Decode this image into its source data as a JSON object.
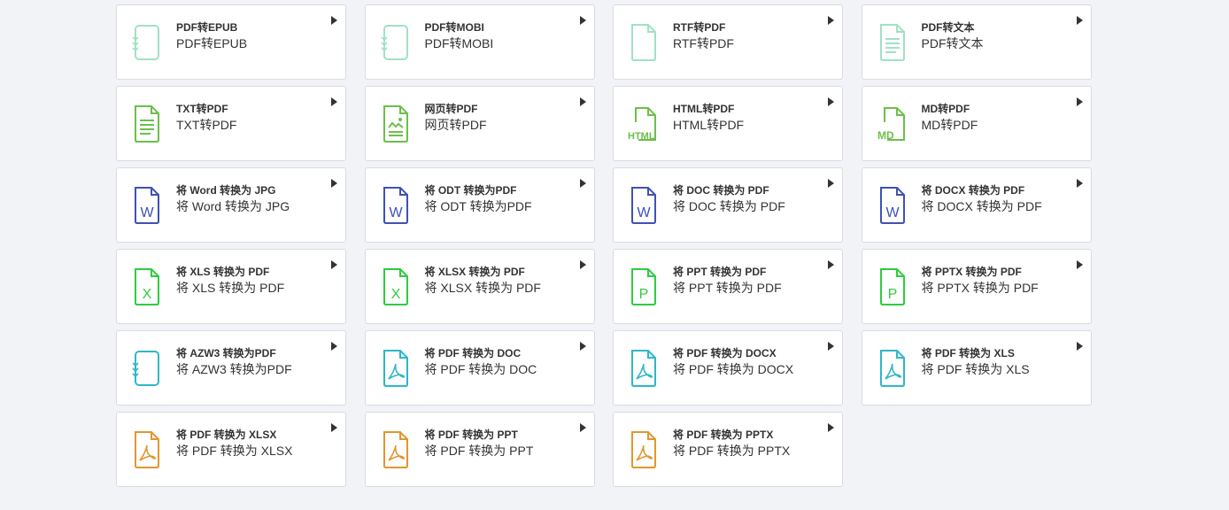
{
  "colors": {
    "mint": "#9fe2c4",
    "green": "#6cbf4a",
    "blue": "#3f51b5",
    "lime": "#2ecc40",
    "teal": "#2eb7c8",
    "orange": "#e3962e"
  },
  "cards": [
    {
      "title": "PDF转EPUB",
      "subtitle": "PDF转EPUB",
      "icon": "ebook-icon",
      "color": "#9fe2c4"
    },
    {
      "title": "PDF转MOBI",
      "subtitle": "PDF转MOBI",
      "icon": "ebook-icon",
      "color": "#9fe2c4"
    },
    {
      "title": "RTF转PDF",
      "subtitle": "RTF转PDF",
      "icon": "blank-file-icon",
      "color": "#9fe2c4"
    },
    {
      "title": "PDF转文本",
      "subtitle": "PDF转文本",
      "icon": "text-file-icon",
      "color": "#9fe2c4"
    },
    {
      "title": "TXT转PDF",
      "subtitle": "TXT转PDF",
      "icon": "text-file-icon",
      "color": "#6cbf4a"
    },
    {
      "title": "网页转PDF",
      "subtitle": "网页转PDF",
      "icon": "webpage-file-icon",
      "color": "#6cbf4a"
    },
    {
      "title": "HTML转PDF",
      "subtitle": "HTML转PDF",
      "icon": "html-file-icon",
      "color": "#6cbf4a",
      "badge": "HTML"
    },
    {
      "title": "MD转PDF",
      "subtitle": "MD转PDF",
      "icon": "md-file-icon",
      "color": "#6cbf4a",
      "badge": "MD"
    },
    {
      "title": "将 Word 转换为 JPG",
      "subtitle": "将 Word 转换为 JPG",
      "icon": "word-file-icon",
      "color": "#3f51b5",
      "letter": "W"
    },
    {
      "title": "将 ODT 转换为PDF",
      "subtitle": "将 ODT 转换为PDF",
      "icon": "word-file-icon",
      "color": "#3f51b5",
      "letter": "W"
    },
    {
      "title": "将 DOC 转换为 PDF",
      "subtitle": "将 DOC 转换为 PDF",
      "icon": "word-file-icon",
      "color": "#3f51b5",
      "letter": "W"
    },
    {
      "title": "将 DOCX 转换为 PDF",
      "subtitle": "将 DOCX 转换为 PDF",
      "icon": "word-file-icon",
      "color": "#3f51b5",
      "letter": "W"
    },
    {
      "title": "将 XLS 转换为 PDF",
      "subtitle": "将 XLS 转换为 PDF",
      "icon": "excel-file-icon",
      "color": "#2ecc40",
      "letter": "X"
    },
    {
      "title": "将 XLSX 转换为 PDF",
      "subtitle": "将 XLSX 转换为 PDF",
      "icon": "excel-file-icon",
      "color": "#2ecc40",
      "letter": "X"
    },
    {
      "title": "将 PPT 转换为 PDF",
      "subtitle": "将 PPT 转换为 PDF",
      "icon": "powerpoint-file-icon",
      "color": "#2ecc40",
      "letter": "P"
    },
    {
      "title": "将 PPTX 转换为 PDF",
      "subtitle": "将 PPTX 转换为 PDF",
      "icon": "powerpoint-file-icon",
      "color": "#2ecc40",
      "letter": "P"
    },
    {
      "title": "将 AZW3 转换为PDF",
      "subtitle": "将 AZW3 转换为PDF",
      "icon": "ebook-icon",
      "color": "#2eb7c8"
    },
    {
      "title": "将 PDF 转换为 DOC",
      "subtitle": "将 PDF 转换为 DOC",
      "icon": "pdf-file-icon",
      "color": "#2eb7c8"
    },
    {
      "title": "将 PDF 转换为 DOCX",
      "subtitle": "将 PDF 转换为 DOCX",
      "icon": "pdf-file-icon",
      "color": "#2eb7c8"
    },
    {
      "title": "将 PDF 转换为 XLS",
      "subtitle": "将 PDF 转换为 XLS",
      "icon": "pdf-file-icon",
      "color": "#2eb7c8"
    },
    {
      "title": "将 PDF 转换为 XLSX",
      "subtitle": "将 PDF 转换为 XLSX",
      "icon": "pdf-file-icon",
      "color": "#e3962e"
    },
    {
      "title": "将 PDF 转换为 PPT",
      "subtitle": "将 PDF 转换为 PPT",
      "icon": "pdf-file-icon",
      "color": "#e3962e"
    },
    {
      "title": "将 PDF 转换为 PPTX",
      "subtitle": "将 PDF 转换为 PPTX",
      "icon": "pdf-file-icon",
      "color": "#e3962e"
    }
  ]
}
